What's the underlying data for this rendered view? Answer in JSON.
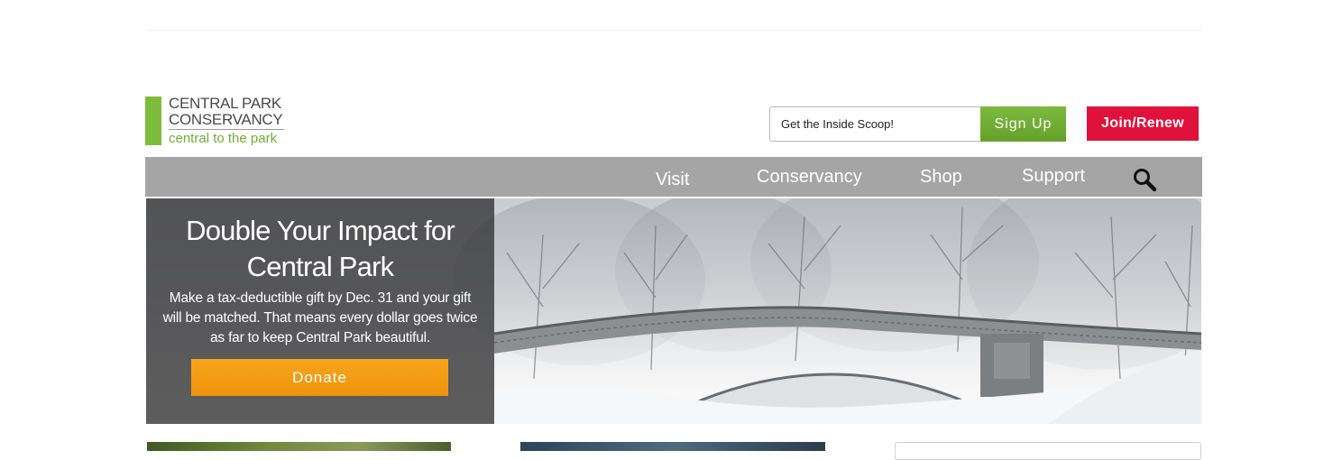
{
  "logo": {
    "line1": "CENTRAL PARK",
    "line2": "CONSERVANCY",
    "tagline": "central to the park",
    "accent_color": "#7dbb3a"
  },
  "newsletter": {
    "placeholder": "Get the Inside Scoop!",
    "signup_label": "Sign Up",
    "signup_color": "#6fad33"
  },
  "join": {
    "label": "Join/Renew",
    "color": "#e0123b"
  },
  "nav": {
    "items": [
      {
        "label": "Visit"
      },
      {
        "label": "Conservancy"
      },
      {
        "label": "Shop"
      },
      {
        "label": "Support"
      }
    ],
    "search_icon": "magnifier-icon",
    "background": "#a5a5a5"
  },
  "hero": {
    "title": "Double Your Impact for Central Park",
    "body": "Make a tax-deductible gift by Dec. 31 and your gift will be matched. That means every dollar goes twice as far to keep Central Park beautiful.",
    "donate_label": "Donate",
    "donate_color": "#f39a12"
  }
}
